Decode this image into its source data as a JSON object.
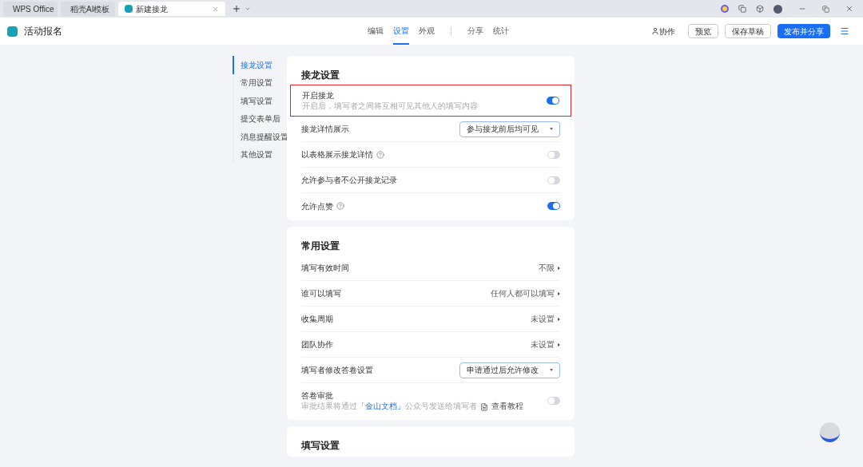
{
  "browser_tabs": [
    {
      "label": "WPS Office",
      "kind": "wps",
      "selected": false
    },
    {
      "label": "稻壳AI模板",
      "kind": "docer",
      "selected": false
    },
    {
      "label": "新建接龙",
      "kind": "form",
      "selected": true
    }
  ],
  "app": {
    "title": "活动报名"
  },
  "nav_groups": [
    {
      "tabs": [
        {
          "label": "编辑",
          "selected": false
        },
        {
          "label": "设置",
          "selected": true
        },
        {
          "label": "外观",
          "selected": false
        }
      ]
    },
    {
      "tabs": [
        {
          "label": "分享",
          "selected": false
        },
        {
          "label": "统计",
          "selected": false
        }
      ]
    }
  ],
  "collaborate": "协作",
  "buttons": [
    {
      "label": "预览",
      "kind": "outline"
    },
    {
      "label": "保存草稿",
      "kind": "outline"
    },
    {
      "label": "发布并分享",
      "kind": "primary"
    }
  ],
  "side_nav": [
    {
      "label": "接龙设置",
      "selected": true
    },
    {
      "label": "常用设置",
      "selected": false
    },
    {
      "label": "填写设置",
      "selected": false
    },
    {
      "label": "提交表单后",
      "selected": false
    },
    {
      "label": "消息提醒设置",
      "selected": false
    },
    {
      "label": "其他设置",
      "selected": false
    }
  ],
  "sections": [
    {
      "title": "接龙设置",
      "rows": [
        {
          "kind": "toggle",
          "label": "开启接龙",
          "description": "开启后，填写者之间将互相可见其他人的填写内容",
          "on": true,
          "highlighted": true,
          "help": false
        },
        {
          "kind": "select",
          "label": "接龙详情展示",
          "value": "参与接龙前后均可见"
        },
        {
          "kind": "toggle",
          "label": "以表格展示接龙详情",
          "on": false,
          "highlighted": false,
          "help": true
        },
        {
          "kind": "toggle",
          "label": "允许参与者不公开接龙记录",
          "on": false,
          "highlighted": false,
          "help": false
        },
        {
          "kind": "toggle",
          "label": "允许点赞",
          "on": true,
          "highlighted": false,
          "help": true
        }
      ]
    },
    {
      "title": "常用设置",
      "rows": [
        {
          "kind": "link",
          "label": "填写有效时间",
          "value": "不限"
        },
        {
          "kind": "link",
          "label": "谁可以填写",
          "value": "任何人都可以填写"
        },
        {
          "kind": "link",
          "label": "收集周期",
          "value": "未设置"
        },
        {
          "kind": "link",
          "label": "团队协作",
          "value": "未设置"
        },
        {
          "kind": "select",
          "label": "填写者修改答卷设置",
          "value": "申请通过后允许修改"
        },
        {
          "kind": "toggle",
          "label": "答卷审批",
          "on": false,
          "highlighted": false,
          "help": false,
          "note": {
            "before": "审批结果将通过",
            "link": "「金山文档」",
            "after": "公众号发送给填写者",
            "tutorial": "查看教程"
          }
        }
      ]
    },
    {
      "title": "填写设置"
    }
  ]
}
